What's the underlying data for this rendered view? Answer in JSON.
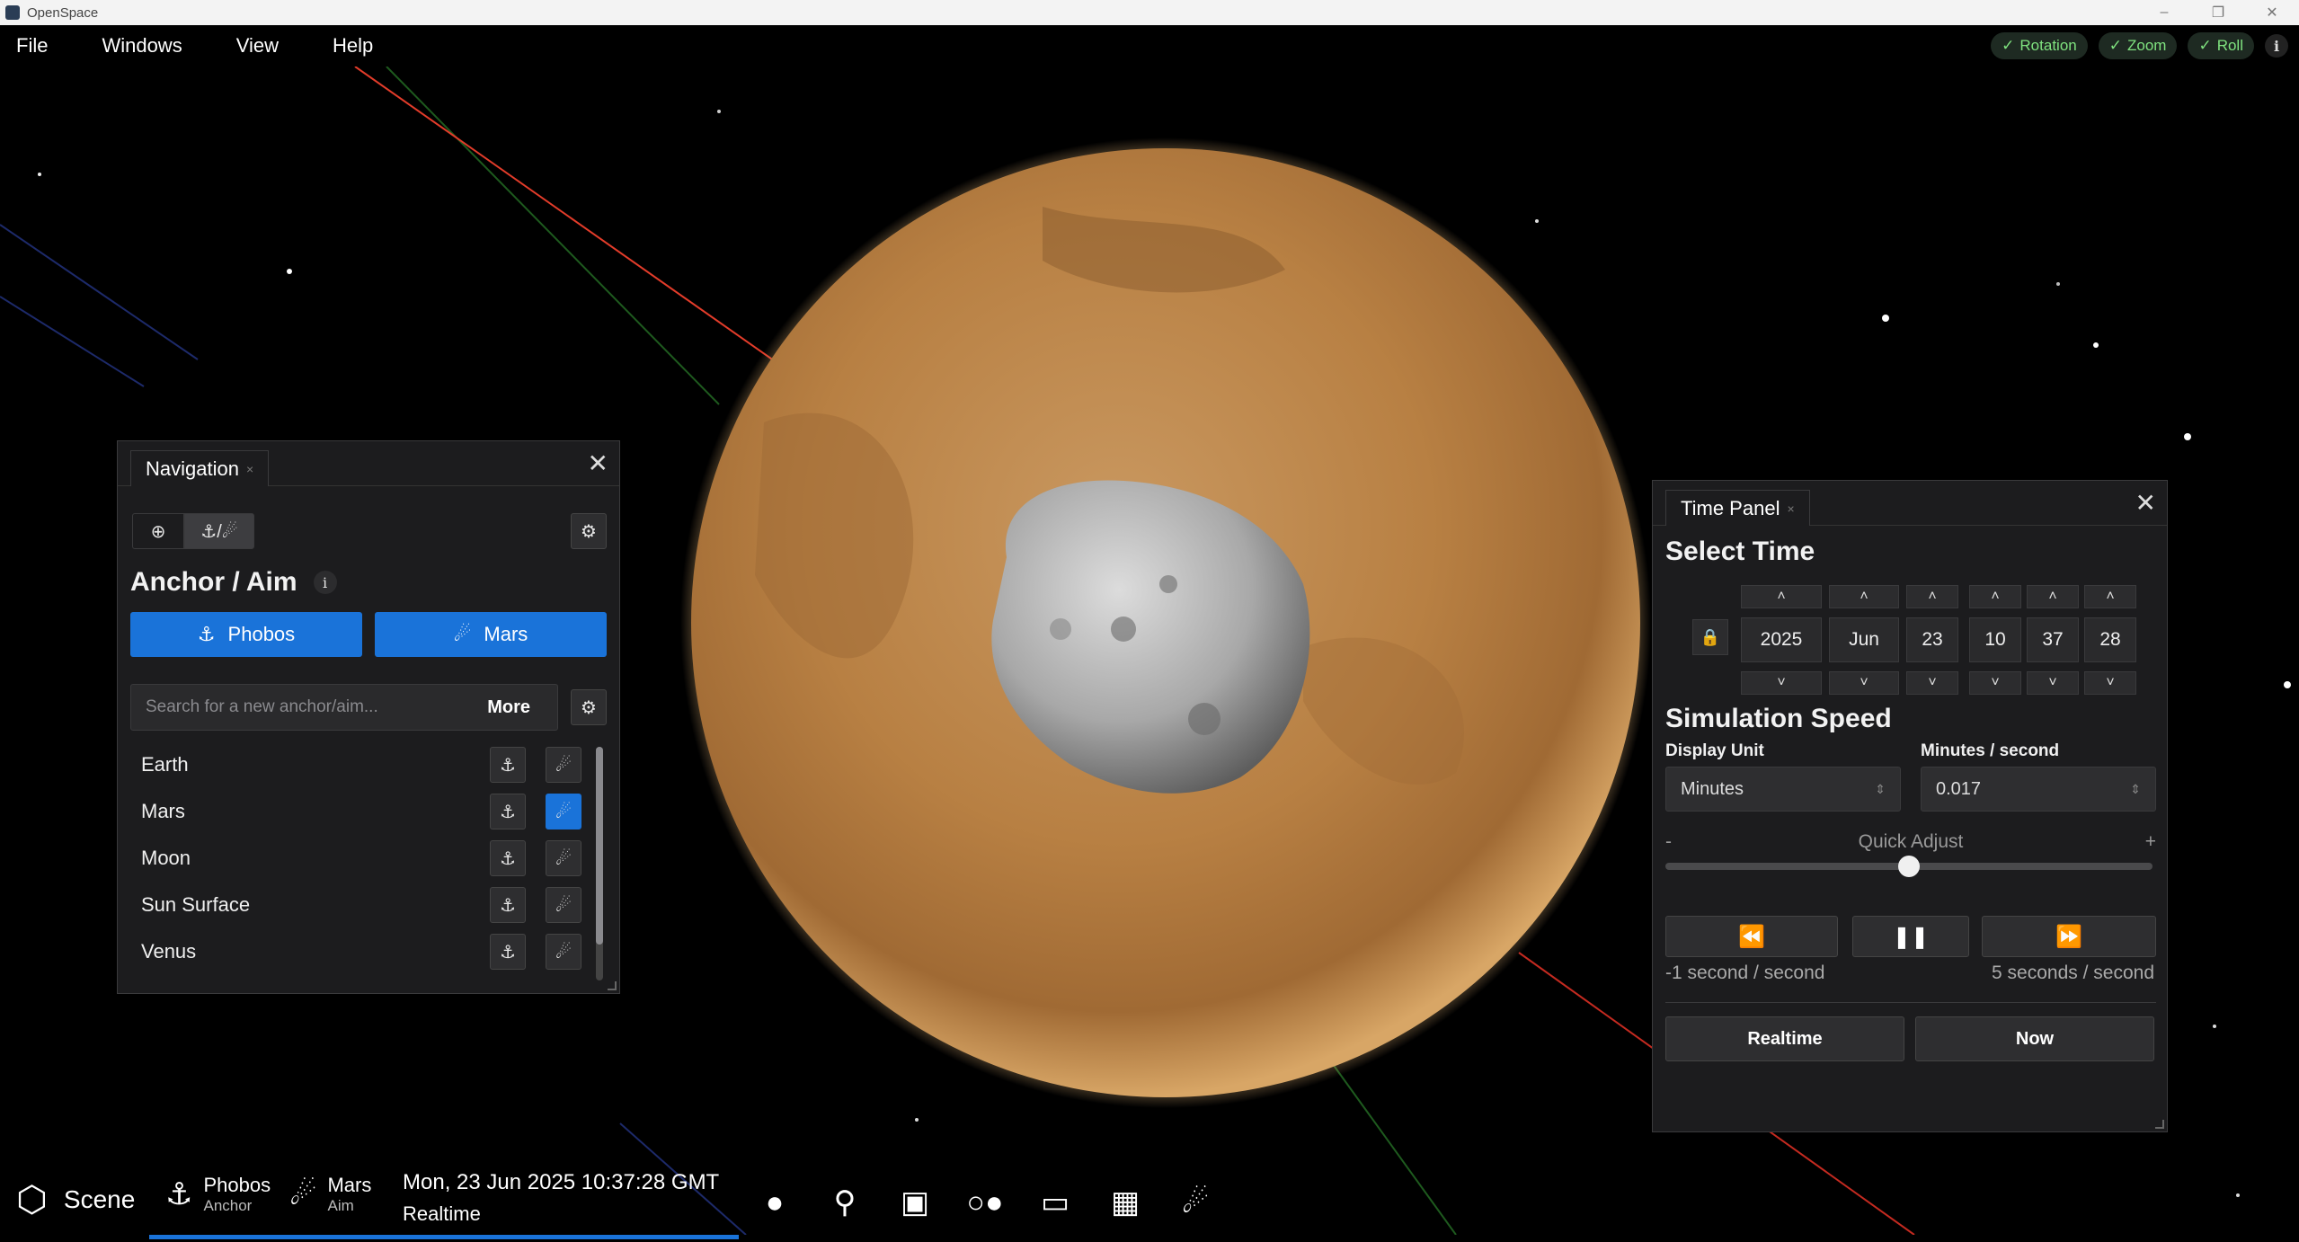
{
  "window": {
    "title": "OpenSpace"
  },
  "menubar": {
    "items": [
      "File",
      "Windows",
      "View",
      "Help"
    ],
    "toggles": [
      {
        "label": "Rotation",
        "checked": true
      },
      {
        "label": "Zoom",
        "checked": true
      },
      {
        "label": "Roll",
        "checked": true
      }
    ]
  },
  "navigation": {
    "tab_title": "Navigation",
    "heading": "Anchor / Aim",
    "anchor_button": "Phobos",
    "aim_button": "Mars",
    "search_placeholder": "Search for a new anchor/aim...",
    "more_label": "More",
    "items": [
      {
        "name": "Earth",
        "aim_selected": false
      },
      {
        "name": "Mars",
        "aim_selected": true
      },
      {
        "name": "Moon",
        "aim_selected": false
      },
      {
        "name": "Sun Surface",
        "aim_selected": false
      },
      {
        "name": "Venus",
        "aim_selected": false
      }
    ]
  },
  "time_panel": {
    "tab_title": "Time Panel",
    "select_time_heading": "Select Time",
    "year": "2025",
    "month": "Jun",
    "day": "23",
    "hour": "10",
    "minute": "37",
    "second": "28",
    "simulation_speed_heading": "Simulation Speed",
    "display_unit_label": "Display Unit",
    "display_unit_value": "Minutes",
    "rate_label": "Minutes / second",
    "rate_value": "0.017",
    "quick_adjust_label": "Quick Adjust",
    "quick_adjust_minus": "-",
    "quick_adjust_plus": "+",
    "quick_adjust_position": 0.5,
    "backward_speed": "-1 second / second",
    "forward_speed": "5 seconds / second",
    "realtime_label": "Realtime",
    "now_label": "Now"
  },
  "bottombar": {
    "scene_label": "Scene",
    "anchor_name": "Phobos",
    "anchor_sub": "Anchor",
    "aim_name": "Mars",
    "aim_sub": "Aim",
    "datetime": "Mon, 23 Jun 2025 10:37:28 GMT",
    "time_mode": "Realtime",
    "icons": [
      "camera-icon",
      "location-pin-icon",
      "image-icon",
      "toggle-dots-icon",
      "browser-window-icon",
      "dashboard-icon",
      "telescope-icon"
    ]
  },
  "colors": {
    "accent": "#1a73d9",
    "toggle_check": "#7fe27f",
    "mars": "#c0874a",
    "panel_bg": "#1c1c1e"
  }
}
